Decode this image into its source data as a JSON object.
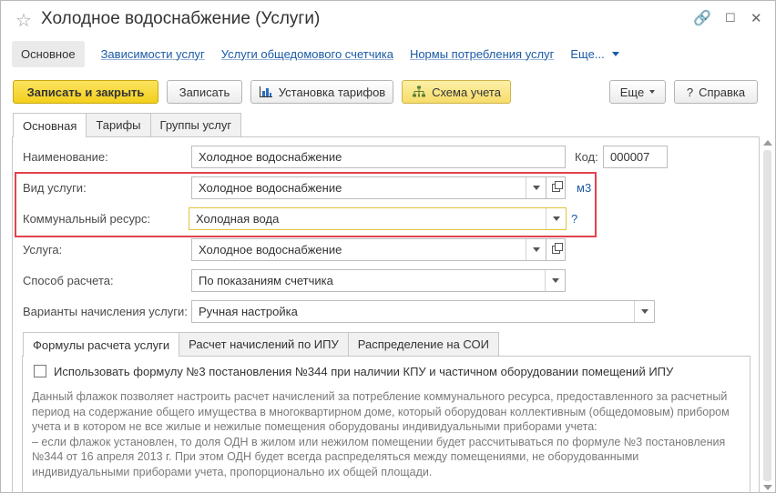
{
  "window": {
    "title": "Холодное водоснабжение (Услуги)",
    "controls": {
      "link": "🔗",
      "more": "⋮",
      "maximize": "☐",
      "close": "✕"
    }
  },
  "nav": {
    "active": "Основное",
    "links": [
      "Зависимости услуг",
      "Услуги общедомового счетчика",
      "Нормы потребления услуг"
    ],
    "more": "Еще..."
  },
  "toolbar": {
    "save_close": "Записать и закрыть",
    "save": "Записать",
    "tariffs": "Установка тарифов",
    "scheme": "Схема учета",
    "more": "Еще",
    "help": "Справка",
    "help_prefix": "?"
  },
  "tabs": [
    "Основная",
    "Тарифы",
    "Группы услуг"
  ],
  "form": {
    "name_label": "Наименование:",
    "name_value": "Холодное водоснабжение",
    "code_label": "Код:",
    "code_value": "000007",
    "service_type_label": "Вид услуги:",
    "service_type_value": "Холодное водоснабжение",
    "unit": "м3",
    "resource_label": "Коммунальный ресурс:",
    "resource_value": "Холодная вода",
    "resource_hint": "?",
    "service_label": "Услуга:",
    "service_value": "Холодное водоснабжение",
    "calc_method_label": "Способ расчета:",
    "calc_method_value": "По показаниям счетчика",
    "variants_label": "Варианты начисления услуги:",
    "variants_value": "Ручная настройка"
  },
  "inner_tabs": [
    "Формулы расчета услуги",
    "Расчет начислений по ИПУ",
    "Распределение на СОИ"
  ],
  "formula": {
    "checkbox_label": "Использовать формулу №3 постановления №344 при наличии КПУ и частичном оборудовании помещений ИПУ",
    "checked": false,
    "description": "Данный флажок позволяет настроить расчет начислений за потребление коммунального ресурса, предоставленного за расчетный период на содержание общего имущества в многоквартирном доме, который оборудован коллективным (общедомовым) прибором учета и в котором не все жилые и нежилые помещения оборудованы индивидуальными приборами учета:\n– если флажок установлен, то доля ОДН в жилом или нежилом помещении будет рассчитываться по формуле №3 постановления №344 от 16 апреля 2013 г. При этом ОДН будет всегда распределяться между помещениями, не оборудованными индивидуальными приборами учета, пропорционально их общей площади."
  },
  "colors": {
    "accent_yellow": "#f3cf1c",
    "link_blue": "#1b5aa5",
    "highlight_red": "#e0434b"
  }
}
